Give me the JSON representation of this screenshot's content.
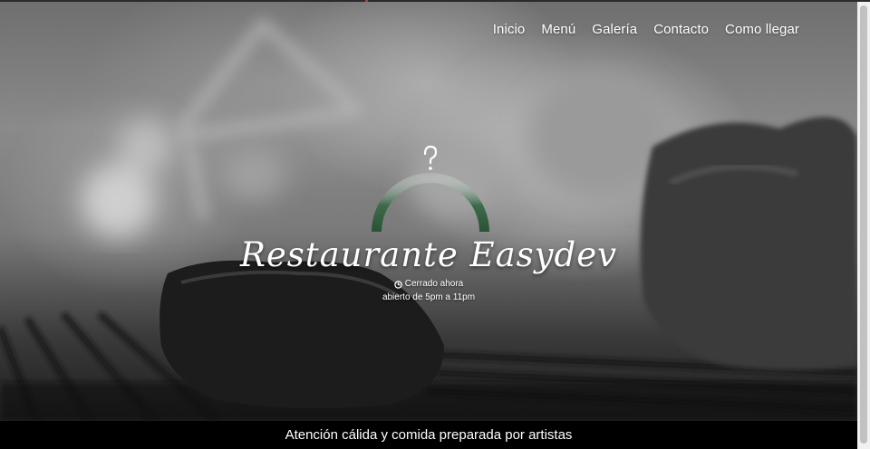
{
  "nav": {
    "items": [
      "Inicio",
      "Menú",
      "Galería",
      "Contacto",
      "Como llegar"
    ]
  },
  "hero": {
    "title": "Restaurante Easydev",
    "status": "Cerrado ahora",
    "hours": "abierto de 5pm a 11pm",
    "logo_icon": "cloche-icon",
    "status_icon": "clock-icon"
  },
  "footer": {
    "tagline": "Atención cálida y comida preparada por artistas"
  },
  "colors": {
    "logo_green": "#2f5a3c",
    "footer_bg": "#000000",
    "text": "#ffffff"
  }
}
